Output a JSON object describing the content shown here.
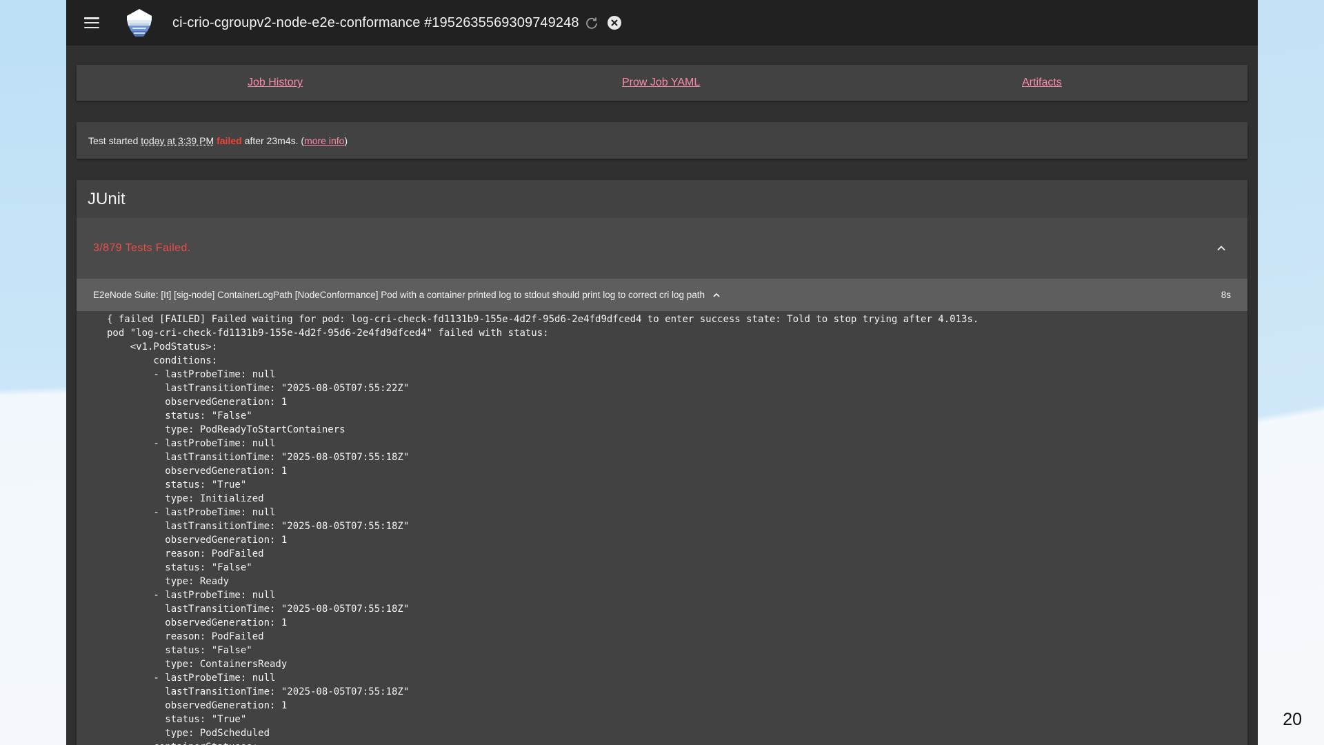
{
  "header": {
    "title": "ci-crio-cgroupv2-node-e2e-conformance #1952635569309749248"
  },
  "links": {
    "job_history": "Job History",
    "prow_job_yaml": "Prow Job YAML",
    "artifacts": "Artifacts"
  },
  "status": {
    "prefix": "Test started",
    "started": "today at 3:39 PM",
    "result": "failed",
    "duration_text": "after 23m4s. (",
    "more_info": "more info",
    "suffix": ")"
  },
  "junit": {
    "title": "JUnit",
    "summary": "3/879 Tests Failed.",
    "test_name": "E2eNode Suite: [It] [sig-node] ContainerLogPath [NodeConformance] Pod with a container printed log to stdout should print log to correct cri log path",
    "test_duration": "8s",
    "log_lines": [
      "{ failed [FAILED] Failed waiting for pod: log-cri-check-fd1131b9-155e-4d2f-95d6-2e4fd9dfced4 to enter success state: Told to stop trying after 4.013s.",
      "pod \"log-cri-check-fd1131b9-155e-4d2f-95d6-2e4fd9dfced4\" failed with status:",
      "    <v1.PodStatus>:",
      "        conditions:",
      "        - lastProbeTime: null",
      "          lastTransitionTime: \"2025-08-05T07:55:22Z\"",
      "          observedGeneration: 1",
      "          status: \"False\"",
      "          type: PodReadyToStartContainers",
      "        - lastProbeTime: null",
      "          lastTransitionTime: \"2025-08-05T07:55:18Z\"",
      "          observedGeneration: 1",
      "          status: \"True\"",
      "          type: Initialized",
      "        - lastProbeTime: null",
      "          lastTransitionTime: \"2025-08-05T07:55:18Z\"",
      "          observedGeneration: 1",
      "          reason: PodFailed",
      "          status: \"False\"",
      "          type: Ready",
      "        - lastProbeTime: null",
      "          lastTransitionTime: \"2025-08-05T07:55:18Z\"",
      "          observedGeneration: 1",
      "          reason: PodFailed",
      "          status: \"False\"",
      "          type: ContainersReady",
      "        - lastProbeTime: null",
      "          lastTransitionTime: \"2025-08-05T07:55:18Z\"",
      "          observedGeneration: 1",
      "          status: \"True\"",
      "          type: PodScheduled",
      "        containerStatuses:"
    ]
  },
  "slide": {
    "page_number": "20"
  },
  "colors": {
    "link": "#f88aa6",
    "failed": "#f44336",
    "summary": "#ef4d4a"
  },
  "icons": {
    "menu": "menu-icon",
    "logo": "prow-logo-icon",
    "refresh": "refresh-icon",
    "close": "close-icon",
    "collapse": "chevron-up-icon"
  }
}
